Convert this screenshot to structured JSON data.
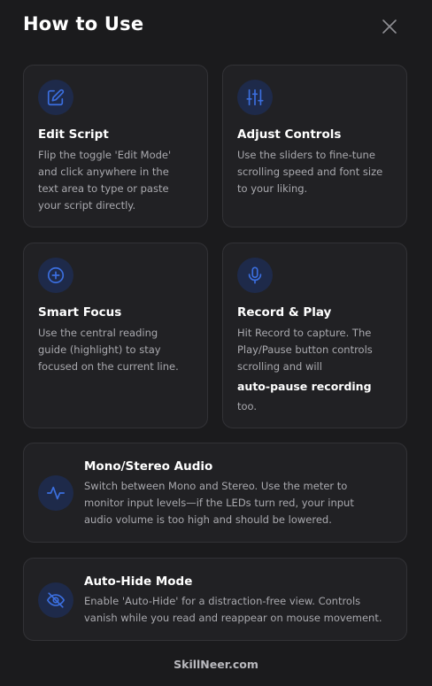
{
  "dialog": {
    "title": "How to Use"
  },
  "cards": [
    {
      "title": "Edit Script",
      "icon": "edit-icon",
      "desc": [
        "Flip the toggle 'Edit Mode'",
        "and click anywhere in the",
        "text area to type or paste",
        "your script directly."
      ]
    },
    {
      "title": "Adjust Controls",
      "icon": "sliders-icon",
      "desc": [
        "Use the sliders to fine-tune",
        "scrolling speed and font size",
        "to your liking."
      ]
    },
    {
      "title": "Smart Focus",
      "icon": "crosshair-icon",
      "desc": [
        "Use the central reading",
        "guide (highlight) to stay",
        "focused on the current line."
      ]
    },
    {
      "title": "Record & Play",
      "icon": "microphone-icon",
      "desc": [
        "Hit Record to capture. The",
        "Play/Pause button controls",
        "scrolling and will"
      ],
      "emphasis": "auto-pause recording",
      "desc_tail": "too."
    },
    {
      "title": "Mono/Stereo Audio",
      "icon": "waveform-icon",
      "desc": [
        "Switch between Mono and Stereo. Use the meter to",
        "monitor input levels—if the LEDs turn red, your input",
        "audio volume is too high and should be lowered."
      ]
    },
    {
      "title": "Auto-Hide Mode",
      "icon": "eye-off-icon",
      "desc": [
        "Enable 'Auto-Hide' for a distraction-free view. Controls",
        "vanish while you read and reappear on mouse movement."
      ]
    }
  ],
  "footer": {
    "brand": "SkillNeer.com"
  },
  "colors": {
    "background": "#1b1b1d",
    "card": "#212124",
    "icon_bg": "#1e2a4a",
    "accent": "#3b6fe0"
  }
}
